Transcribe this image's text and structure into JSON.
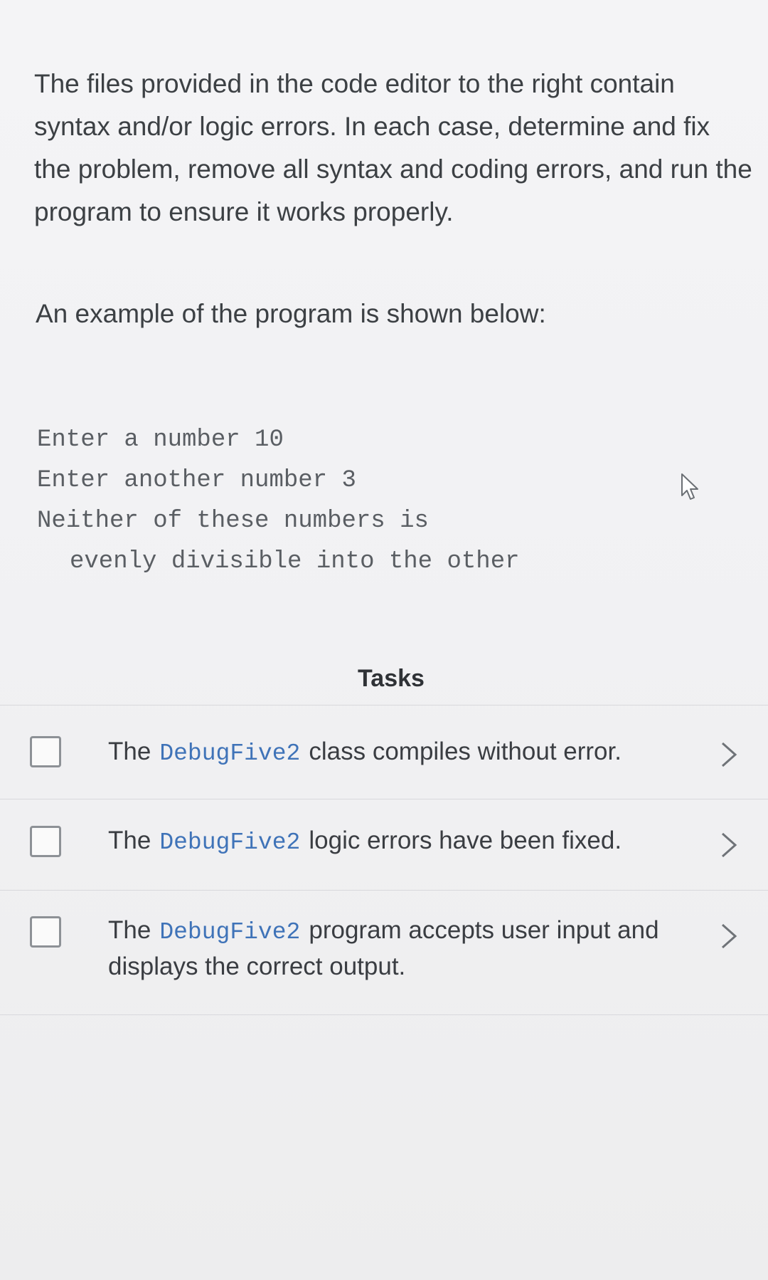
{
  "intro": {
    "paragraph": "The files provided in the code editor to the right contain syntax and/or logic errors. In each case, determine and fix the problem, remove all syntax and coding errors, and run the program to ensure it works properly."
  },
  "example": {
    "heading": "An example of the program is shown below:",
    "console_lines": [
      "Enter a number 10",
      "Enter another number 3",
      "Neither of these numbers is",
      "evenly divisible into the other"
    ]
  },
  "tasks": {
    "title": "Tasks",
    "items": [
      {
        "prefix": "The",
        "code": "DebugFive2",
        "suffix": "class compiles without error.",
        "checked": false
      },
      {
        "prefix": "The",
        "code": "DebugFive2",
        "suffix": "logic errors have been fixed.",
        "checked": false
      },
      {
        "prefix": "The",
        "code": "DebugFive2",
        "suffix": "program accepts user input and displays the correct output.",
        "checked": false
      }
    ]
  },
  "icons": {
    "cursor": "mouse-pointer-icon",
    "chevron": "chevron-right-icon"
  },
  "colors": {
    "code_text": "#3f73b8",
    "body_text": "#3c4044",
    "checkbox_border": "#8d9196"
  }
}
